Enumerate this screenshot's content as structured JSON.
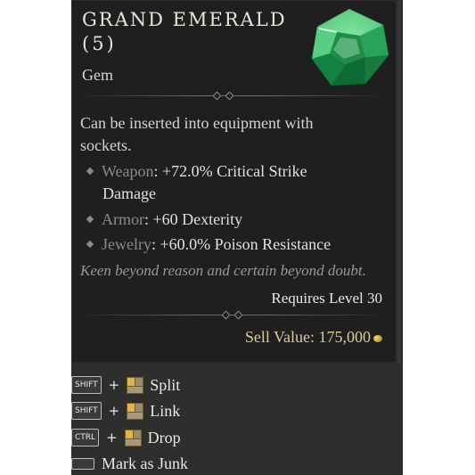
{
  "item": {
    "name": "GRAND EMERALD",
    "tier": "(5)",
    "type": "Gem",
    "description": "Can be inserted into equipment with sockets.",
    "affixes": [
      {
        "slot": "Weapon",
        "effect": ": +72.0% Critical Strike",
        "effect_cont": "Damage"
      },
      {
        "slot": "Armor",
        "effect": ": +60 Dexterity",
        "effect_cont": ""
      },
      {
        "slot": "Jewelry",
        "effect": ": +60.0% Poison Resistance",
        "effect_cont": ""
      }
    ],
    "flavor_text": "Keen beyond reason and certain beyond doubt.",
    "requirement": "Requires Level 30",
    "sell_value_label": "Sell Value: 175,000",
    "gem_color": "#2fae5c"
  },
  "hints": [
    {
      "key": "SHIFT",
      "action": "Split"
    },
    {
      "key": "SHIFT",
      "action": "Link"
    },
    {
      "key": "CTRL",
      "action": "Drop"
    },
    {
      "key": "",
      "action": "Mark as Junk"
    }
  ],
  "icons": {
    "gem": "emerald-gem-icon",
    "gold": "gold-coin-icon",
    "mouse": "mouse-left-click-icon"
  }
}
